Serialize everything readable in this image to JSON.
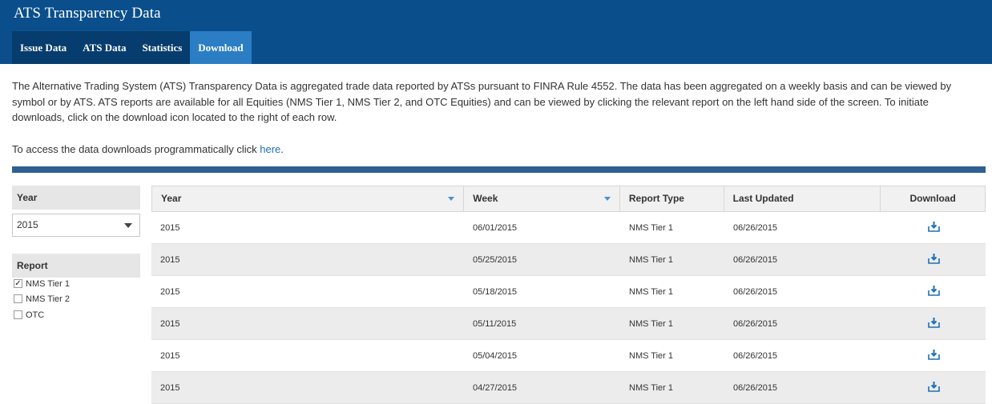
{
  "app": {
    "title": "ATS Transparency Data"
  },
  "nav": {
    "tabs": [
      {
        "label": "Issue Data",
        "active": false
      },
      {
        "label": "ATS Data",
        "active": false
      },
      {
        "label": "Statistics",
        "active": false
      },
      {
        "label": "Download",
        "active": true
      }
    ]
  },
  "intro": {
    "paragraph": "The Alternative Trading System (ATS) Transparency Data is aggregated trade data reported by ATSs pursuant to FINRA Rule 4552. The data has been aggregated on a weekly basis and can be viewed by symbol or by ATS. ATS reports are available for all Equities (NMS Tier 1, NMS Tier 2, and OTC Equities) and can be viewed by clicking the relevant report on the left hand side of the screen. To initiate downloads, click on the download icon located to the right of each row.",
    "access_prefix": "To access the data downloads programmatically click ",
    "access_link": "here",
    "access_suffix": "."
  },
  "filters": {
    "year_header": "Year",
    "year_value": "2015",
    "report_header": "Report",
    "reports": [
      {
        "label": "NMS Tier 1",
        "checked": true
      },
      {
        "label": "NMS Tier 2",
        "checked": false
      },
      {
        "label": "OTC",
        "checked": false
      }
    ]
  },
  "table": {
    "columns": [
      "Year",
      "Week",
      "Report Type",
      "Last Updated",
      "Download"
    ],
    "rows": [
      {
        "year": "2015",
        "week": "06/01/2015",
        "report_type": "NMS Tier 1",
        "last_updated": "06/26/2015"
      },
      {
        "year": "2015",
        "week": "05/25/2015",
        "report_type": "NMS Tier 1",
        "last_updated": "06/26/2015"
      },
      {
        "year": "2015",
        "week": "05/18/2015",
        "report_type": "NMS Tier 1",
        "last_updated": "06/26/2015"
      },
      {
        "year": "2015",
        "week": "05/11/2015",
        "report_type": "NMS Tier 1",
        "last_updated": "06/26/2015"
      },
      {
        "year": "2015",
        "week": "05/04/2015",
        "report_type": "NMS Tier 1",
        "last_updated": "06/26/2015"
      },
      {
        "year": "2015",
        "week": "04/27/2015",
        "report_type": "NMS Tier 1",
        "last_updated": "06/26/2015"
      }
    ],
    "download_icon": "download-icon"
  },
  "colors": {
    "header": "#0a4f8c",
    "nav": "#063d6e",
    "active_tab": "#2b7ec4",
    "band": "#2f5f93",
    "link": "#1f6fb5"
  }
}
